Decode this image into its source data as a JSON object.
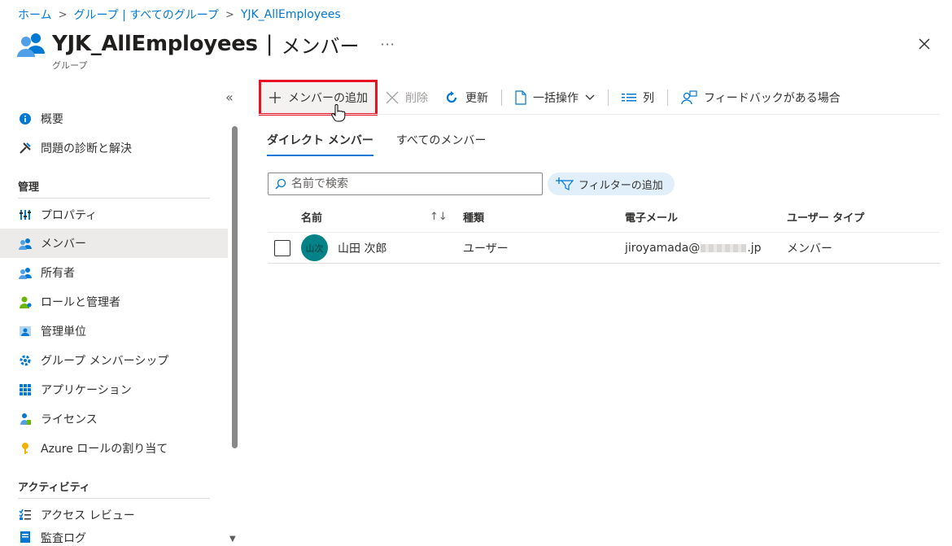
{
  "breadcrumb": {
    "items": [
      "ホーム",
      "グループ | すべてのグループ",
      "YJK_AllEmployees"
    ]
  },
  "header": {
    "title": "YJK_AllEmployees",
    "separator": "|",
    "section": "メンバー",
    "more": "···",
    "subtitle": "グループ"
  },
  "sidebar": {
    "collapse": "«",
    "items_top": [
      {
        "label": "概要",
        "icon": "info-icon"
      },
      {
        "label": "問題の診断と解決",
        "icon": "wrench-icon"
      }
    ],
    "section_manage": "管理",
    "items_manage": [
      {
        "label": "プロパティ",
        "icon": "properties-icon"
      },
      {
        "label": "メンバー",
        "icon": "members-icon"
      },
      {
        "label": "所有者",
        "icon": "owners-icon"
      },
      {
        "label": "ロールと管理者",
        "icon": "roles-icon"
      },
      {
        "label": "管理単位",
        "icon": "admin-units-icon"
      },
      {
        "label": "グループ メンバーシップ",
        "icon": "group-membership-icon"
      },
      {
        "label": "アプリケーション",
        "icon": "applications-icon"
      },
      {
        "label": "ライセンス",
        "icon": "licenses-icon"
      },
      {
        "label": "Azure ロールの割り当て",
        "icon": "key-icon"
      }
    ],
    "section_activity": "アクティビティ",
    "items_activity": [
      {
        "label": "アクセス レビュー",
        "icon": "access-review-icon"
      },
      {
        "label": "監査ログ",
        "icon": "audit-log-icon"
      }
    ],
    "active_item": "メンバー"
  },
  "toolbar": {
    "add_member": "メンバーの追加",
    "delete": "削除",
    "refresh": "更新",
    "bulk": "一括操作",
    "columns": "列",
    "feedback": "フィードバックがある場合"
  },
  "tabs": [
    "ダイレクト メンバー",
    "すべてのメンバー"
  ],
  "search": {
    "placeholder": "名前で検索"
  },
  "filter": {
    "label": "フィルターの追加"
  },
  "table": {
    "headers": [
      "名前",
      "種類",
      "電子メール",
      "ユーザー タイプ"
    ],
    "sort_glyph": "↑↓",
    "rows": [
      {
        "avatar": "山次",
        "name": "山田 次郎",
        "type": "ユーザー",
        "email_user": "jiroyamada@",
        "email_tld": ".jp",
        "user_type": "メンバー"
      }
    ]
  },
  "colors": {
    "accent": "#0078d4",
    "highlight": "#e81123",
    "avatar": "#038387"
  }
}
